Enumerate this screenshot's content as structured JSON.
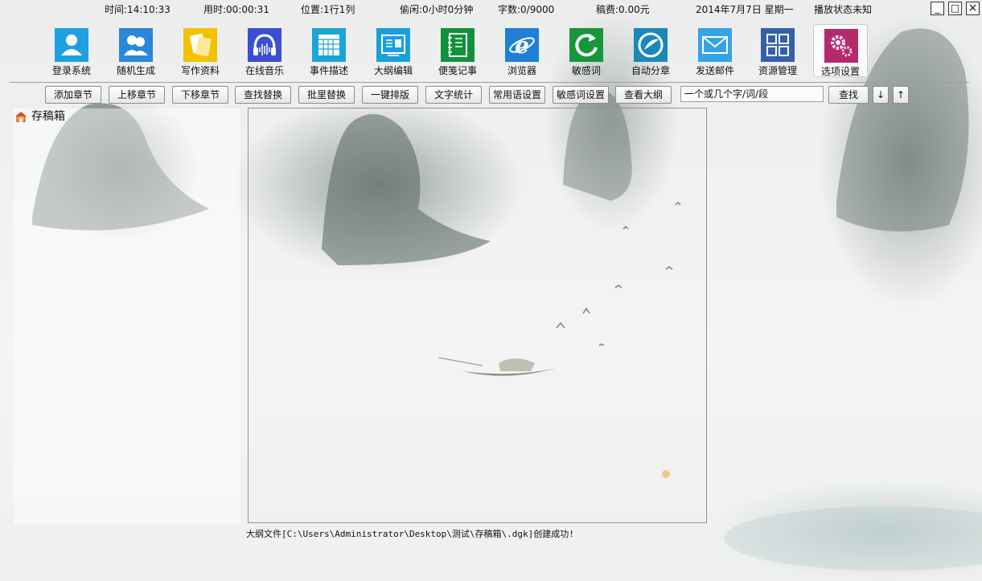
{
  "status": {
    "time": "时间:14:10:33",
    "elapsed": "用时:00:00:31",
    "position": "位置:1行1列",
    "idle": "偷闲:0小时0分钟",
    "wordcount": "字数:0/9000",
    "fee": "稿费:0.00元",
    "date": "2014年7月7日  星期一",
    "playback": "播放状态未知"
  },
  "window_controls": {
    "minimize": "_",
    "maximize": "□",
    "close": "×"
  },
  "toolbar": [
    {
      "label": "登录系统",
      "icon": "user-icon",
      "color": "#1ea0e0"
    },
    {
      "label": "随机生成",
      "icon": "users-icon",
      "color": "#2a88d8"
    },
    {
      "label": "写作资料",
      "icon": "documents-icon",
      "color": "#f2c200"
    },
    {
      "label": "在线音乐",
      "icon": "headphones-icon",
      "color": "#3b4fd0"
    },
    {
      "label": "事件描述",
      "icon": "calendar-icon",
      "color": "#1aa5d6"
    },
    {
      "label": "大纲编辑",
      "icon": "outline-icon",
      "color": "#1aa0d8"
    },
    {
      "label": "便笺记事",
      "icon": "notebook-icon",
      "color": "#12913c"
    },
    {
      "label": "浏览器",
      "icon": "browser-icon",
      "color": "#1e7fd4"
    },
    {
      "label": "敏感词",
      "icon": "refresh-icon",
      "color": "#17953c"
    },
    {
      "label": "自动分章",
      "icon": "split-icon",
      "color": "#1b88b8"
    },
    {
      "label": "发送邮件",
      "icon": "mail-icon",
      "color": "#36a3e6"
    },
    {
      "label": "资源管理",
      "icon": "grid-icon",
      "color": "#3560a8"
    },
    {
      "label": "选项设置",
      "icon": "gears-icon",
      "color": "#b52a6c"
    }
  ],
  "buttons": {
    "add_chapter": "添加章节",
    "move_up": "上移章节",
    "move_down": "下移章节",
    "find_replace": "查找替换",
    "batch_replace": "批里替换",
    "auto_format": "一键排版",
    "word_stats": "文字统计",
    "phrases": "常用语设置",
    "sensitive": "敏感词设置",
    "view_outline": "查看大纲",
    "search": "查找",
    "next": "↓",
    "prev": "↑"
  },
  "search_placeholder": "一个或几个字/词/段",
  "tree": {
    "root": "存稿箱",
    "root_icon": "home-folder-icon"
  },
  "message": "大纲文件[C:\\Users\\Administrator\\Desktop\\测试\\存稿箱\\.dgk]创建成功!"
}
